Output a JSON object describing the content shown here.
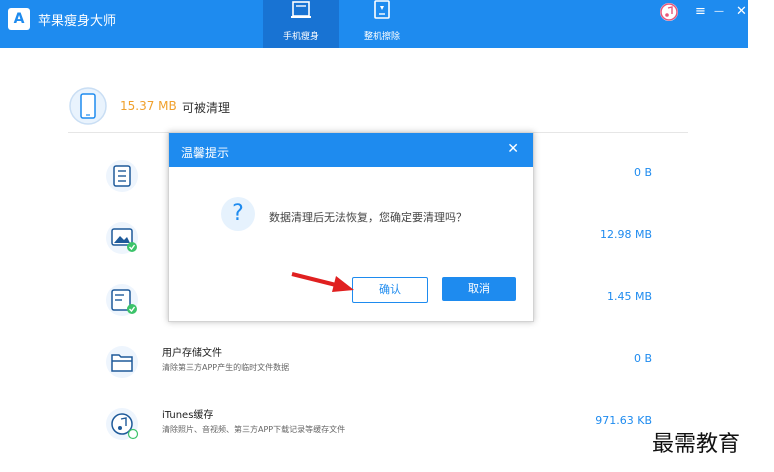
{
  "app": {
    "title": "苹果瘦身大师"
  },
  "tabs": [
    {
      "label": "手机瘦身",
      "active": true,
      "icon": "phone-clean-icon"
    },
    {
      "label": "整机擦除",
      "active": false,
      "icon": "phone-erase-icon"
    }
  ],
  "window_controls": {
    "menu": "≡",
    "minimize": "—",
    "close": "✕"
  },
  "summary": {
    "size": "15.37 MB",
    "text": "可被清理"
  },
  "rows": [
    {
      "title": "",
      "desc": "",
      "size": "0 B",
      "icon": "list-icon"
    },
    {
      "title": "",
      "desc": "",
      "size": "12.98 MB",
      "icon": "image-icon"
    },
    {
      "title": "",
      "desc": "",
      "size": "1.45 MB",
      "icon": "temp-file-icon"
    },
    {
      "title": "用户存储文件",
      "desc": "清除第三方APP产生的临时文件数据",
      "size": "0 B",
      "icon": "folder-icon"
    },
    {
      "title": "iTunes缓存",
      "desc": "清除照片、音视频、第三方APP下载记录等缓存文件",
      "size": "971.63 KB",
      "icon": "music-icon"
    }
  ],
  "dialog": {
    "title": "温馨提示",
    "message": "数据清理后无法恢复，您确定要清理吗？",
    "ok": "确认",
    "cancel": "取消",
    "close": "✕"
  },
  "watermark": "最需教育",
  "colors": {
    "accent": "#1e8bef",
    "size_highlight": "#f0a02c",
    "check": "#3cc36a"
  }
}
